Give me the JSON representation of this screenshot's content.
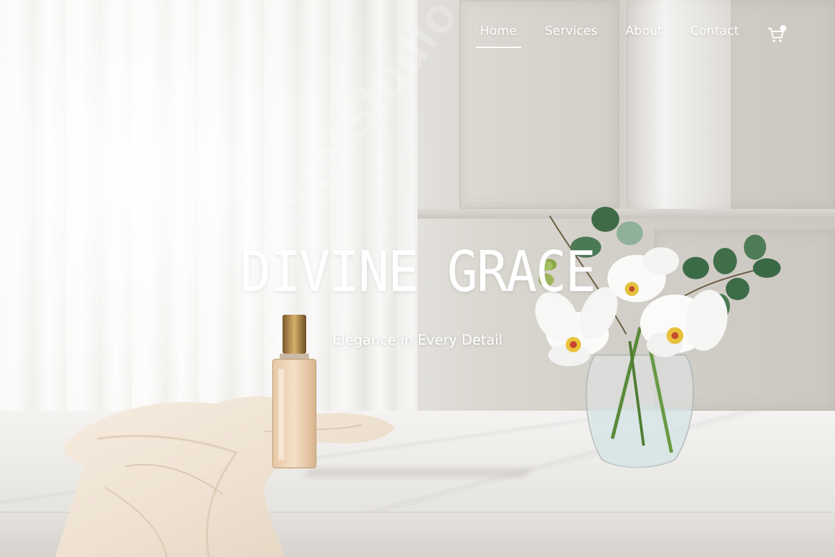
{
  "nav": {
    "links": [
      {
        "label": "Home",
        "active": true
      },
      {
        "label": "Services",
        "active": false
      },
      {
        "label": "About",
        "active": false
      },
      {
        "label": "Contact",
        "active": false
      }
    ],
    "cart_icon": "shopping-cart-icon"
  },
  "hero": {
    "title": "DIVINE GRACE",
    "subtitle": "Elegance in Every Detail"
  },
  "watermark": "pastelStudio",
  "colors": {
    "nav_text": "#ffffff",
    "hero_text": "#ffffff",
    "wall": "#e3e1dc",
    "marble": "#f1f0ed"
  }
}
